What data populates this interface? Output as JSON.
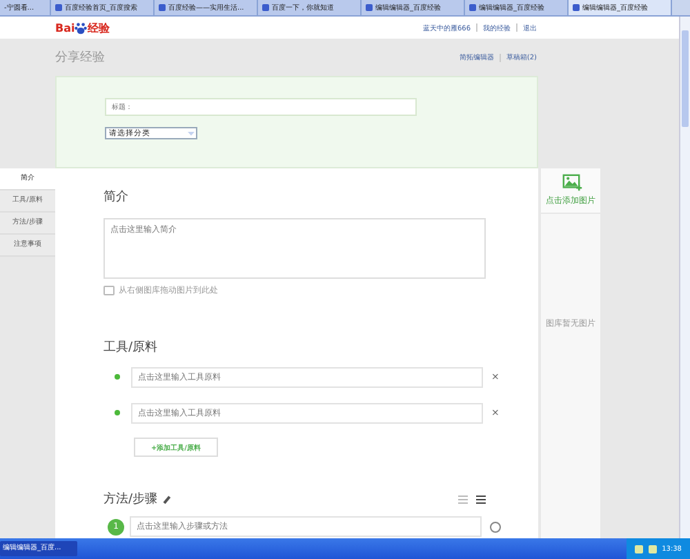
{
  "browser_tabs": [
    {
      "label": "-宁圆看...",
      "selected": false
    },
    {
      "label": "百度经验首页_百度搜索",
      "selected": false
    },
    {
      "label": "百度经验——实用生活...",
      "selected": false
    },
    {
      "label": "百度一下，你就知道",
      "selected": false
    },
    {
      "label": "编辑编辑器_百度经验",
      "selected": false
    },
    {
      "label": "编辑编辑器_百度经验",
      "selected": false
    },
    {
      "label": "编辑编辑器_百度经验",
      "selected": true
    }
  ],
  "header": {
    "logo_text": "Bai",
    "logo_suffix": "经验",
    "user_links": [
      "蓝天中的雁666",
      "我的经验",
      "退出"
    ]
  },
  "page_title": "分享经验",
  "page_links": [
    "简拓编辑器",
    "草稿箱(2)"
  ],
  "title_field": {
    "placeholder": "标题："
  },
  "category_select": {
    "value": "请选择分类"
  },
  "side_nav": [
    {
      "label": "简介",
      "selected": true
    },
    {
      "label": "工具/原料",
      "selected": false
    },
    {
      "label": "方法/步骤",
      "selected": false
    },
    {
      "label": "注意事项",
      "selected": false
    }
  ],
  "intro": {
    "heading": "简介",
    "placeholder": "点击这里输入简介",
    "hint": "从右侧图库拖动图片到此处"
  },
  "tools": {
    "heading": "工具/原料",
    "items": [
      {
        "placeholder": "点击这里输入工具原料",
        "remove": "×"
      },
      {
        "placeholder": "点击这里输入工具原料",
        "remove": "×"
      }
    ],
    "add_button": "+添加工具/原料"
  },
  "steps": {
    "heading": "方法/步骤",
    "items": [
      {
        "number": "1",
        "placeholder": "点击这里输入步骤或方法"
      }
    ]
  },
  "gallery": {
    "add_label": "点击添加图片",
    "empty_text": "图库暂无图片"
  },
  "taskbar": {
    "window": "编辑编辑器_百度...",
    "clock": "13:38"
  }
}
